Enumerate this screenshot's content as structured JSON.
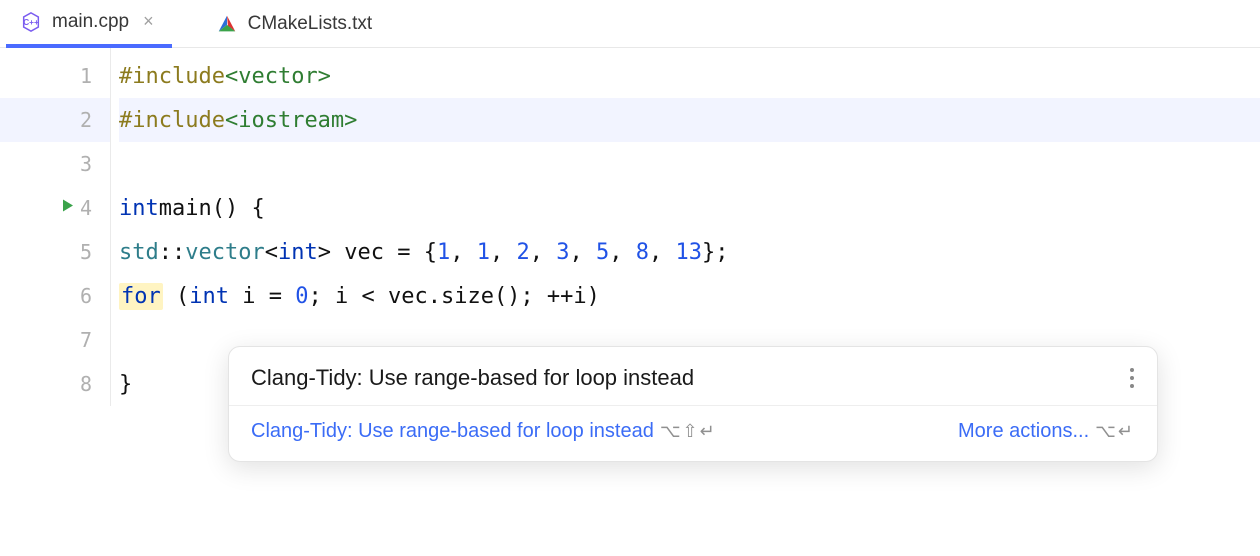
{
  "tabs": [
    {
      "label": "main.cpp",
      "active": true,
      "close": "×"
    },
    {
      "label": "CMakeLists.txt",
      "active": false
    }
  ],
  "gutter_lines": [
    "1",
    "2",
    "3",
    "4",
    "5",
    "6",
    "7",
    "8"
  ],
  "code": {
    "l1": {
      "pre": "#include",
      "inc": "<vector>"
    },
    "l2": {
      "pre": "#include",
      "inc": "<iostream>"
    },
    "l4_int": "int",
    "l4_main": "main",
    "l4_rest": "() {",
    "l5_ns": "std",
    "l5_vec": "vector",
    "l5_tpl": "int",
    "l5_var": "vec",
    "l5_nums": [
      "1",
      "1",
      "2",
      "3",
      "5",
      "8",
      "13"
    ],
    "l6_for": "for",
    "l6_int": "int",
    "l6_i": "i",
    "l6_zero": "0",
    "l6_cond": "i < vec.size(); ++i",
    "l8_brace": "}"
  },
  "tooltip": {
    "title": "Clang-Tidy: Use range-based for loop instead",
    "link": "Clang-Tidy: Use range-based for loop instead",
    "shortcut1": "⌥⇧↵",
    "more": "More actions...",
    "shortcut2": "⌥↵",
    "menu": "⋮"
  }
}
